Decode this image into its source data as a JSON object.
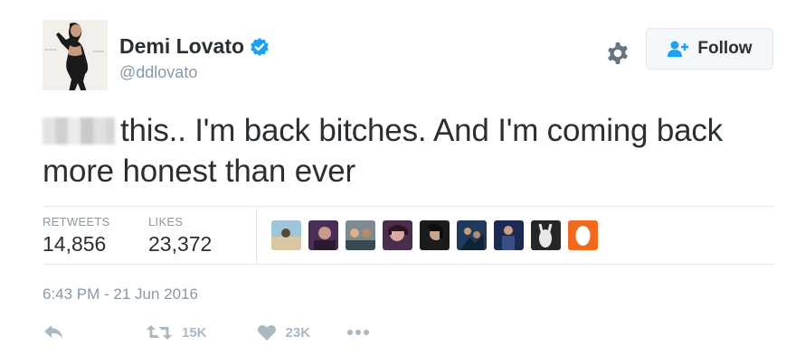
{
  "user": {
    "display_name": "Demi Lovato",
    "handle": "@ddlovato",
    "verified": true,
    "avatar_icon": "profile-photo"
  },
  "header": {
    "settings_icon": "gear-icon",
    "follow_label": "Follow",
    "follow_icon": "add-user-icon"
  },
  "tweet": {
    "text": "this.. I'm back bitches. And I'm coming back more honest than ever"
  },
  "stats": {
    "retweets_label": "RETWEETS",
    "retweets_value": "14,856",
    "likes_label": "LIKES",
    "likes_value": "23,372"
  },
  "likers_count_shown": 9,
  "timestamp": "6:43 PM - 21 Jun 2016",
  "actions": {
    "reply_icon": "reply-icon",
    "retweet_icon": "retweet-icon",
    "retweet_count": "15K",
    "like_icon": "heart-icon",
    "like_count": "23K",
    "more_icon": "more-icon"
  },
  "colors": {
    "text": "#292f33",
    "muted": "#8899a6",
    "verified": "#1da1f2",
    "action_gray": "#aab8c2"
  }
}
